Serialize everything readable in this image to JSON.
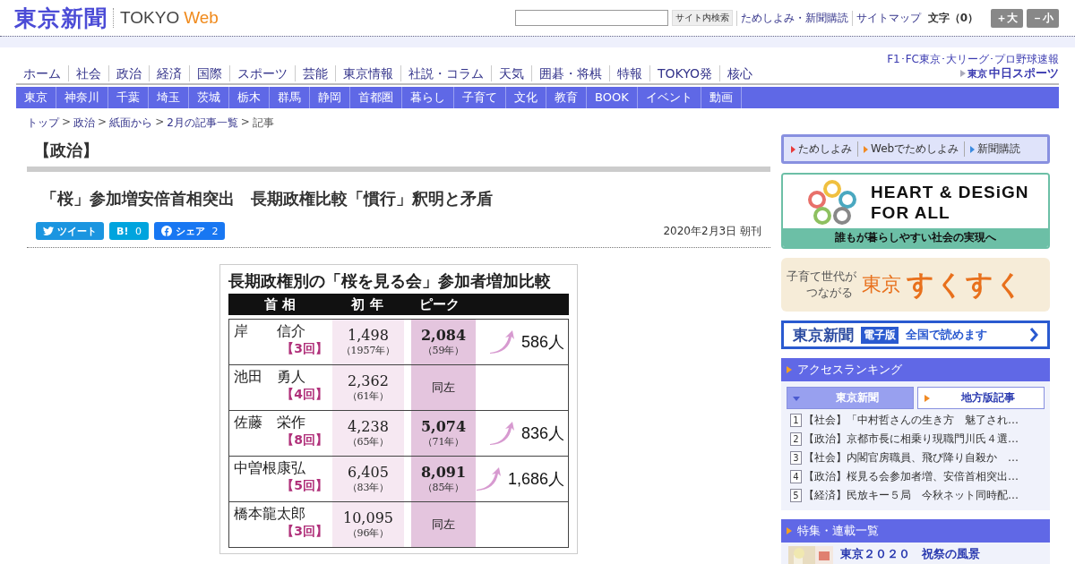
{
  "header": {
    "logo": "東京新聞",
    "sublogo_a": "TOKYO",
    "sublogo_b": "Web",
    "search_button": "サイト内検索",
    "links": [
      "ためしよみ・新聞購読",
      "サイトマップ"
    ],
    "font_size_label": "文字（0）",
    "size_buttons": [
      "＋大",
      "－小"
    ]
  },
  "main_nav": [
    "ホーム",
    "社会",
    "政治",
    "経済",
    "国際",
    "スポーツ",
    "芸能",
    "東京情報",
    "社説・コラム",
    "天気",
    "囲碁・将棋",
    "特報",
    "TOKYO発",
    "核心"
  ],
  "promo": {
    "tagline": "F1･FC東京･大リーグ･プロ野球速報",
    "brand_small": "東京",
    "brand": "中日スポーツ"
  },
  "region_nav": [
    "東京",
    "神奈川",
    "千葉",
    "埼玉",
    "茨城",
    "栃木",
    "群馬",
    "静岡",
    "首都圏",
    "暮らし",
    "子育て",
    "文化",
    "教育",
    "BOOK",
    "イベント",
    "動画"
  ],
  "breadcrumb": {
    "separator": ">",
    "items": [
      "トップ",
      "政治",
      "紙面から",
      "2月の記事一覧",
      "記事"
    ]
  },
  "section_title": "【政治】",
  "headline": "「桜」参加増安倍首相突出　長期政権比較「慣行」釈明と矛盾",
  "share_buttons": [
    {
      "kind": "twitter",
      "label": "ツイート"
    },
    {
      "kind": "hatena",
      "label": "B!",
      "count": "0"
    },
    {
      "kind": "facebook",
      "label": "シェア",
      "count": "2"
    }
  ],
  "dateline": "2020年2月3日 朝刊",
  "figure": {
    "title": "長期政権別の「桜を見る会」参加者増加比較",
    "columns": [
      "首 相",
      "初 年",
      "ピーク"
    ],
    "rows": [
      {
        "name": "岸　　信介",
        "terms": "【3回】",
        "first": "1,498",
        "first_year": "（1957年）",
        "peak": "2,084",
        "peak_year": "（59年）",
        "increase": "586人"
      },
      {
        "name": "池田　勇人",
        "terms": "【4回】",
        "first": "2,362",
        "first_year": "（61年）",
        "peak": "同左"
      },
      {
        "name": "佐藤　栄作",
        "terms": "【8回】",
        "first": "4,238",
        "first_year": "（65年）",
        "peak": "5,074",
        "peak_year": "（71年）",
        "increase": "836人"
      },
      {
        "name": "中曽根康弘",
        "terms": "【5回】",
        "first": "6,405",
        "first_year": "（83年）",
        "peak": "8,091",
        "peak_year": "（85年）",
        "increase": "1,686人"
      },
      {
        "name": "橋本龍太郎",
        "terms": "【3回】",
        "first": "10,095",
        "first_year": "（96年）",
        "peak": "同左"
      }
    ]
  },
  "sidebar": {
    "trial_links": [
      {
        "label": "ためしよみ",
        "color": "#e83a3a"
      },
      {
        "label": "Webでためしよみ",
        "color": "#f08a24"
      },
      {
        "label": "新聞購読",
        "color": "#3a8ae0"
      }
    ],
    "hd_banner": {
      "line1": "HEART & DESiGN",
      "line2": "FOR ALL",
      "caption": "誰もが暮らしやすい社会の実現へ"
    },
    "sukusuku_banner": {
      "tagline_1": "子育て世代が",
      "tagline_2": "つながる",
      "brand_1": "東京",
      "brand_2": "すくすく"
    },
    "edition_banner": {
      "brand": "東京新聞",
      "badge": "電子版",
      "text": "全国で読めます"
    },
    "ranking": {
      "title": "アクセスランキング",
      "tabs": [
        {
          "label": "東京新聞",
          "selected": true
        },
        {
          "label": "地方版記事",
          "selected": false
        }
      ],
      "items": [
        {
          "rank": "1",
          "text": "【社会】「中村哲さんの生き方　魅了され…"
        },
        {
          "rank": "2",
          "text": "【政治】京都市長に相乗り現職門川氏４選…"
        },
        {
          "rank": "3",
          "text": "【社会】内閣官房職員、飛び降り自殺か　…"
        },
        {
          "rank": "4",
          "text": "【政治】桜見る会参加者増、安倍首相突出…"
        },
        {
          "rank": "5",
          "text": "【経済】民放キー５局　今秋ネット同時配…"
        }
      ]
    },
    "features": {
      "title": "特集・連載一覧",
      "items": [
        {
          "title": "東京２０２０　祝祭の風景"
        }
      ]
    }
  }
}
